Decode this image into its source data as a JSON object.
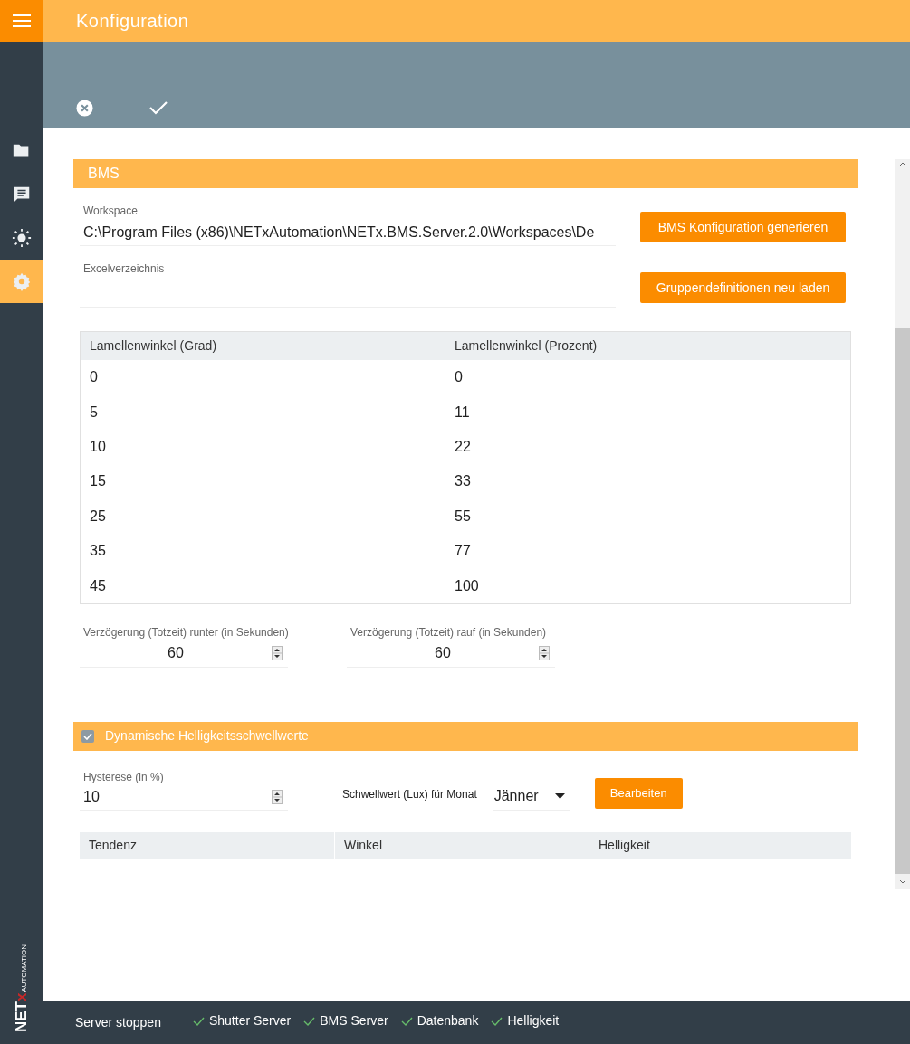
{
  "header": {
    "title": "Konfiguration"
  },
  "sidebar": {
    "items": [
      {
        "kind": "folder",
        "selected": false
      },
      {
        "kind": "chat",
        "selected": false
      },
      {
        "kind": "sun",
        "selected": false
      },
      {
        "kind": "gear",
        "selected": true
      }
    ],
    "logo": {
      "main": "NET",
      "accent": "x",
      "sub": "AUTOMATION"
    }
  },
  "bms": {
    "title": "BMS",
    "workspace": {
      "label": "Workspace",
      "value": "C:\\Program Files (x86)\\NETxAutomation\\NETx.BMS.Server.2.0\\Workspaces\\De"
    },
    "excel": {
      "label": "Excelverzeichnis"
    },
    "buttons": [
      "BMS Konfiguration generieren",
      "Gruppendefinitionen neu laden"
    ],
    "table": {
      "columns": [
        "Lamellenwinkel (Grad)",
        "Lamellenwinkel (Prozent)"
      ],
      "rows": [
        [
          "0",
          "0"
        ],
        [
          "5",
          "11"
        ],
        [
          "10",
          "22"
        ],
        [
          "15",
          "33"
        ],
        [
          "25",
          "55"
        ],
        [
          "35",
          "77"
        ],
        [
          "45",
          "100"
        ]
      ]
    },
    "delays": [
      {
        "label": "Verzögerung (Totzeit) runter (in Sekunden)",
        "value": "60"
      },
      {
        "label": "Verzögerung (Totzeit) rauf (in Sekunden)",
        "value": "60"
      }
    ]
  },
  "dynamic": {
    "title": "Dynamische Helligkeitsschwellwerte",
    "checked": true,
    "hysteresis": {
      "label": "Hysterese (in %)",
      "value": "10"
    },
    "month_label": "Schwellwert (Lux) für Monat",
    "month": "Jänner",
    "edit_button": "Bearbeiten",
    "table": {
      "columns": [
        "Tendenz",
        "Winkel",
        "Helligkeit"
      ]
    }
  },
  "status_bar": {
    "stop": "Server stoppen",
    "services": [
      {
        "label": "Shutter Server",
        "ok": true
      },
      {
        "label": "BMS Server",
        "ok": true
      },
      {
        "label": "Datenbank",
        "ok": true
      },
      {
        "label": "Helligkeit",
        "ok": true
      }
    ]
  }
}
